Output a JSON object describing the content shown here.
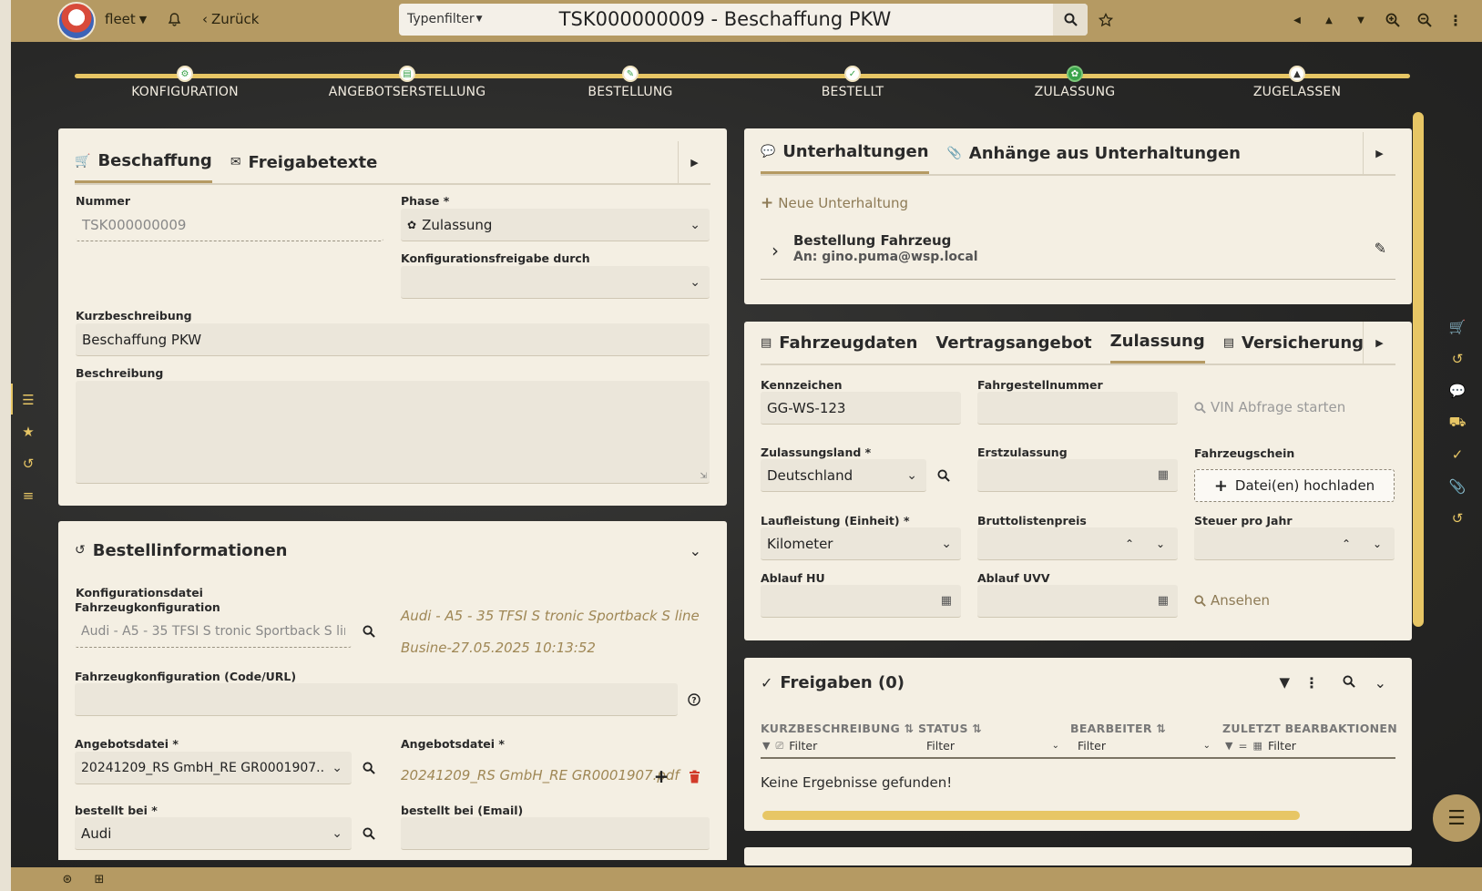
{
  "topbar": {
    "user_menu": "fleet",
    "back": "Zurück",
    "type_filter": "Typenfilter",
    "title": "TSK000000009 - Beschaffung PKW"
  },
  "stepper": {
    "steps": [
      {
        "label": "KONFIGURATION",
        "state": "done"
      },
      {
        "label": "ANGEBOTSERSTELLUNG",
        "state": "done"
      },
      {
        "label": "BESTELLUNG",
        "state": "done"
      },
      {
        "label": "BESTELLT",
        "state": "done"
      },
      {
        "label": "ZULASSUNG",
        "state": "active"
      },
      {
        "label": "ZUGELASSEN",
        "state": "pending"
      }
    ]
  },
  "beschaffung": {
    "tabs": [
      "Beschaffung",
      "Freigabetexte"
    ],
    "nummer_label": "Nummer",
    "nummer_value": "TSK000000009",
    "phase_label": "Phase *",
    "phase_value": "Zulassung",
    "konfig_freigabe_label": "Konfigurationsfreigabe durch",
    "konfig_freigabe_value": "",
    "kurzbeschreibung_label": "Kurzbeschreibung",
    "kurzbeschreibung_value": "Beschaffung PKW",
    "beschreibung_label": "Beschreibung",
    "beschreibung_value": ""
  },
  "bestellinfo": {
    "title": "Bestellinformationen",
    "fahrzeugkonfig_label": "Fahrzeugkonfiguration",
    "fahrzeugkonfig_value": "Audi - A5 - 35 TFSI S tronic Sportback S line ...",
    "konfigdatei_label": "Konfigurationsdatei",
    "konfigdatei_line1": "Audi - A5 - 35 TFSI S tronic Sportback S line",
    "konfigdatei_line2": "Busine-27.05.2025 10:13:52",
    "konfig_code_label": "Fahrzeugkonfiguration (Code/URL)",
    "konfig_code_value": "",
    "angebotsdatei_label": "Angebotsdatei *",
    "angebotsdatei_value": "20241209_RS GmbH_RE GR0001907....",
    "angebotsdatei2_label": "Angebotsdatei *",
    "angebotsdatei2_value": "20241209_RS GmbH_RE GR0001907.pdf",
    "bestellt_bei_label": "bestellt bei *",
    "bestellt_bei_value": "Audi",
    "bestellt_email_label": "bestellt bei (Email)",
    "bestellt_email_value": ""
  },
  "unterhaltungen": {
    "tabs": [
      "Unterhaltungen",
      "Anhänge aus Unterhaltungen"
    ],
    "new_label": "Neue Unterhaltung",
    "item_title": "Bestellung Fahrzeug",
    "item_to": "An: gino.puma@wsp.local"
  },
  "fahrzeug": {
    "tabs": [
      "Fahrzeugdaten",
      "Vertragsangebot",
      "Zulassung",
      "Versicherungsverti"
    ],
    "kennzeichen_label": "Kennzeichen",
    "kennzeichen_value": "GG-WS-123",
    "fgnr_label": "Fahrgestellnummer",
    "fgnr_value": "",
    "vin_link": "VIN Abfrage starten",
    "land_label": "Zulassungsland *",
    "land_value": "Deutschland",
    "erstzul_label": "Erstzulassung",
    "schein_label": "Fahrzeugschein",
    "upload_label": "Datei(en) hochladen",
    "laufleistung_label": "Laufleistung (Einheit) *",
    "laufleistung_value": "Kilometer",
    "brutto_label": "Bruttolistenpreis",
    "steuer_label": "Steuer pro Jahr",
    "hu_label": "Ablauf HU",
    "uvv_label": "Ablauf UVV",
    "ansehen_link": "Ansehen"
  },
  "freigaben": {
    "title": "Freigaben (0)",
    "columns": [
      "KURZBESCHREIBUNG",
      "STATUS",
      "BEARBEITER",
      "ZULETZT BEARBAKTIONEN"
    ],
    "filter_placeholder": "Filter",
    "empty": "Keine Ergebnisse gefunden!"
  }
}
